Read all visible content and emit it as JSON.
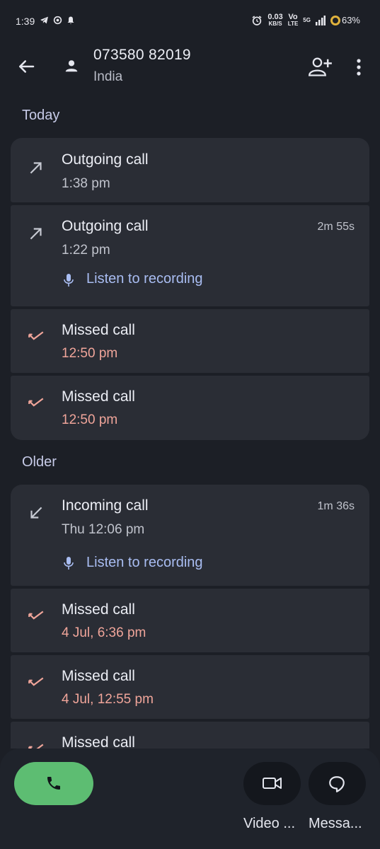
{
  "status_bar": {
    "time": "1:39",
    "net_speed": "0.03",
    "net_unit": "KB/S",
    "volte_top": "Vo",
    "volte_bottom": "LTE",
    "network": "5G",
    "battery": "63%"
  },
  "header": {
    "phone_number": "073580 82019",
    "country": "India"
  },
  "sections": [
    {
      "title": "Today",
      "calls": [
        {
          "type": "outgoing",
          "label": "Outgoing call",
          "time": "1:38 pm",
          "duration": "",
          "recording": ""
        },
        {
          "type": "outgoing",
          "label": "Outgoing call",
          "time": "1:22 pm",
          "duration": "2m 55s",
          "recording": "Listen to recording"
        },
        {
          "type": "missed",
          "label": "Missed call",
          "time": "12:50 pm",
          "duration": "",
          "recording": ""
        },
        {
          "type": "missed",
          "label": "Missed call",
          "time": "12:50 pm",
          "duration": "",
          "recording": ""
        }
      ]
    },
    {
      "title": "Older",
      "calls": [
        {
          "type": "incoming",
          "label": "Incoming call",
          "time": "Thu 12:06 pm",
          "duration": "1m 36s",
          "recording": "Listen to recording"
        },
        {
          "type": "missed",
          "label": "Missed call",
          "time": "4 Jul, 6:36 pm",
          "duration": "",
          "recording": ""
        },
        {
          "type": "missed",
          "label": "Missed call",
          "time": "4 Jul, 12:55 pm",
          "duration": "",
          "recording": ""
        },
        {
          "type": "missed",
          "label": "Missed call",
          "time": "",
          "duration": "",
          "recording": ""
        }
      ]
    }
  ],
  "bottom_bar": {
    "video_label": "Video ...",
    "message_label": "Messa..."
  },
  "colors": {
    "background": "#1c1f26",
    "card": "#2a2d35",
    "missed": "#f0a59a",
    "link": "#a9bdf2",
    "call_button": "#5dbd72"
  }
}
